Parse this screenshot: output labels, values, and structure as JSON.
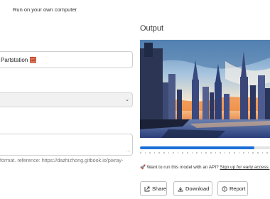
{
  "banner": {
    "text": "Run on your own computer"
  },
  "inputs": {
    "prompt_value": "Partstation 🧱",
    "select_value": "",
    "textarea_value": "",
    "hint": "format. reference: https://dazhizhong.gitbook.io/pixray-"
  },
  "output": {
    "label": "Output",
    "progress_fraction": 0.88,
    "api_note": {
      "icon": "rocket-icon",
      "prefix": "🚀 Want to run this model with an API?",
      "link": "Sign up for early access."
    },
    "buttons": {
      "share": "Share",
      "download": "Download",
      "report": "Report"
    }
  },
  "colors": {
    "accent": "#1d6fd8",
    "border": "#cfcfcf"
  }
}
